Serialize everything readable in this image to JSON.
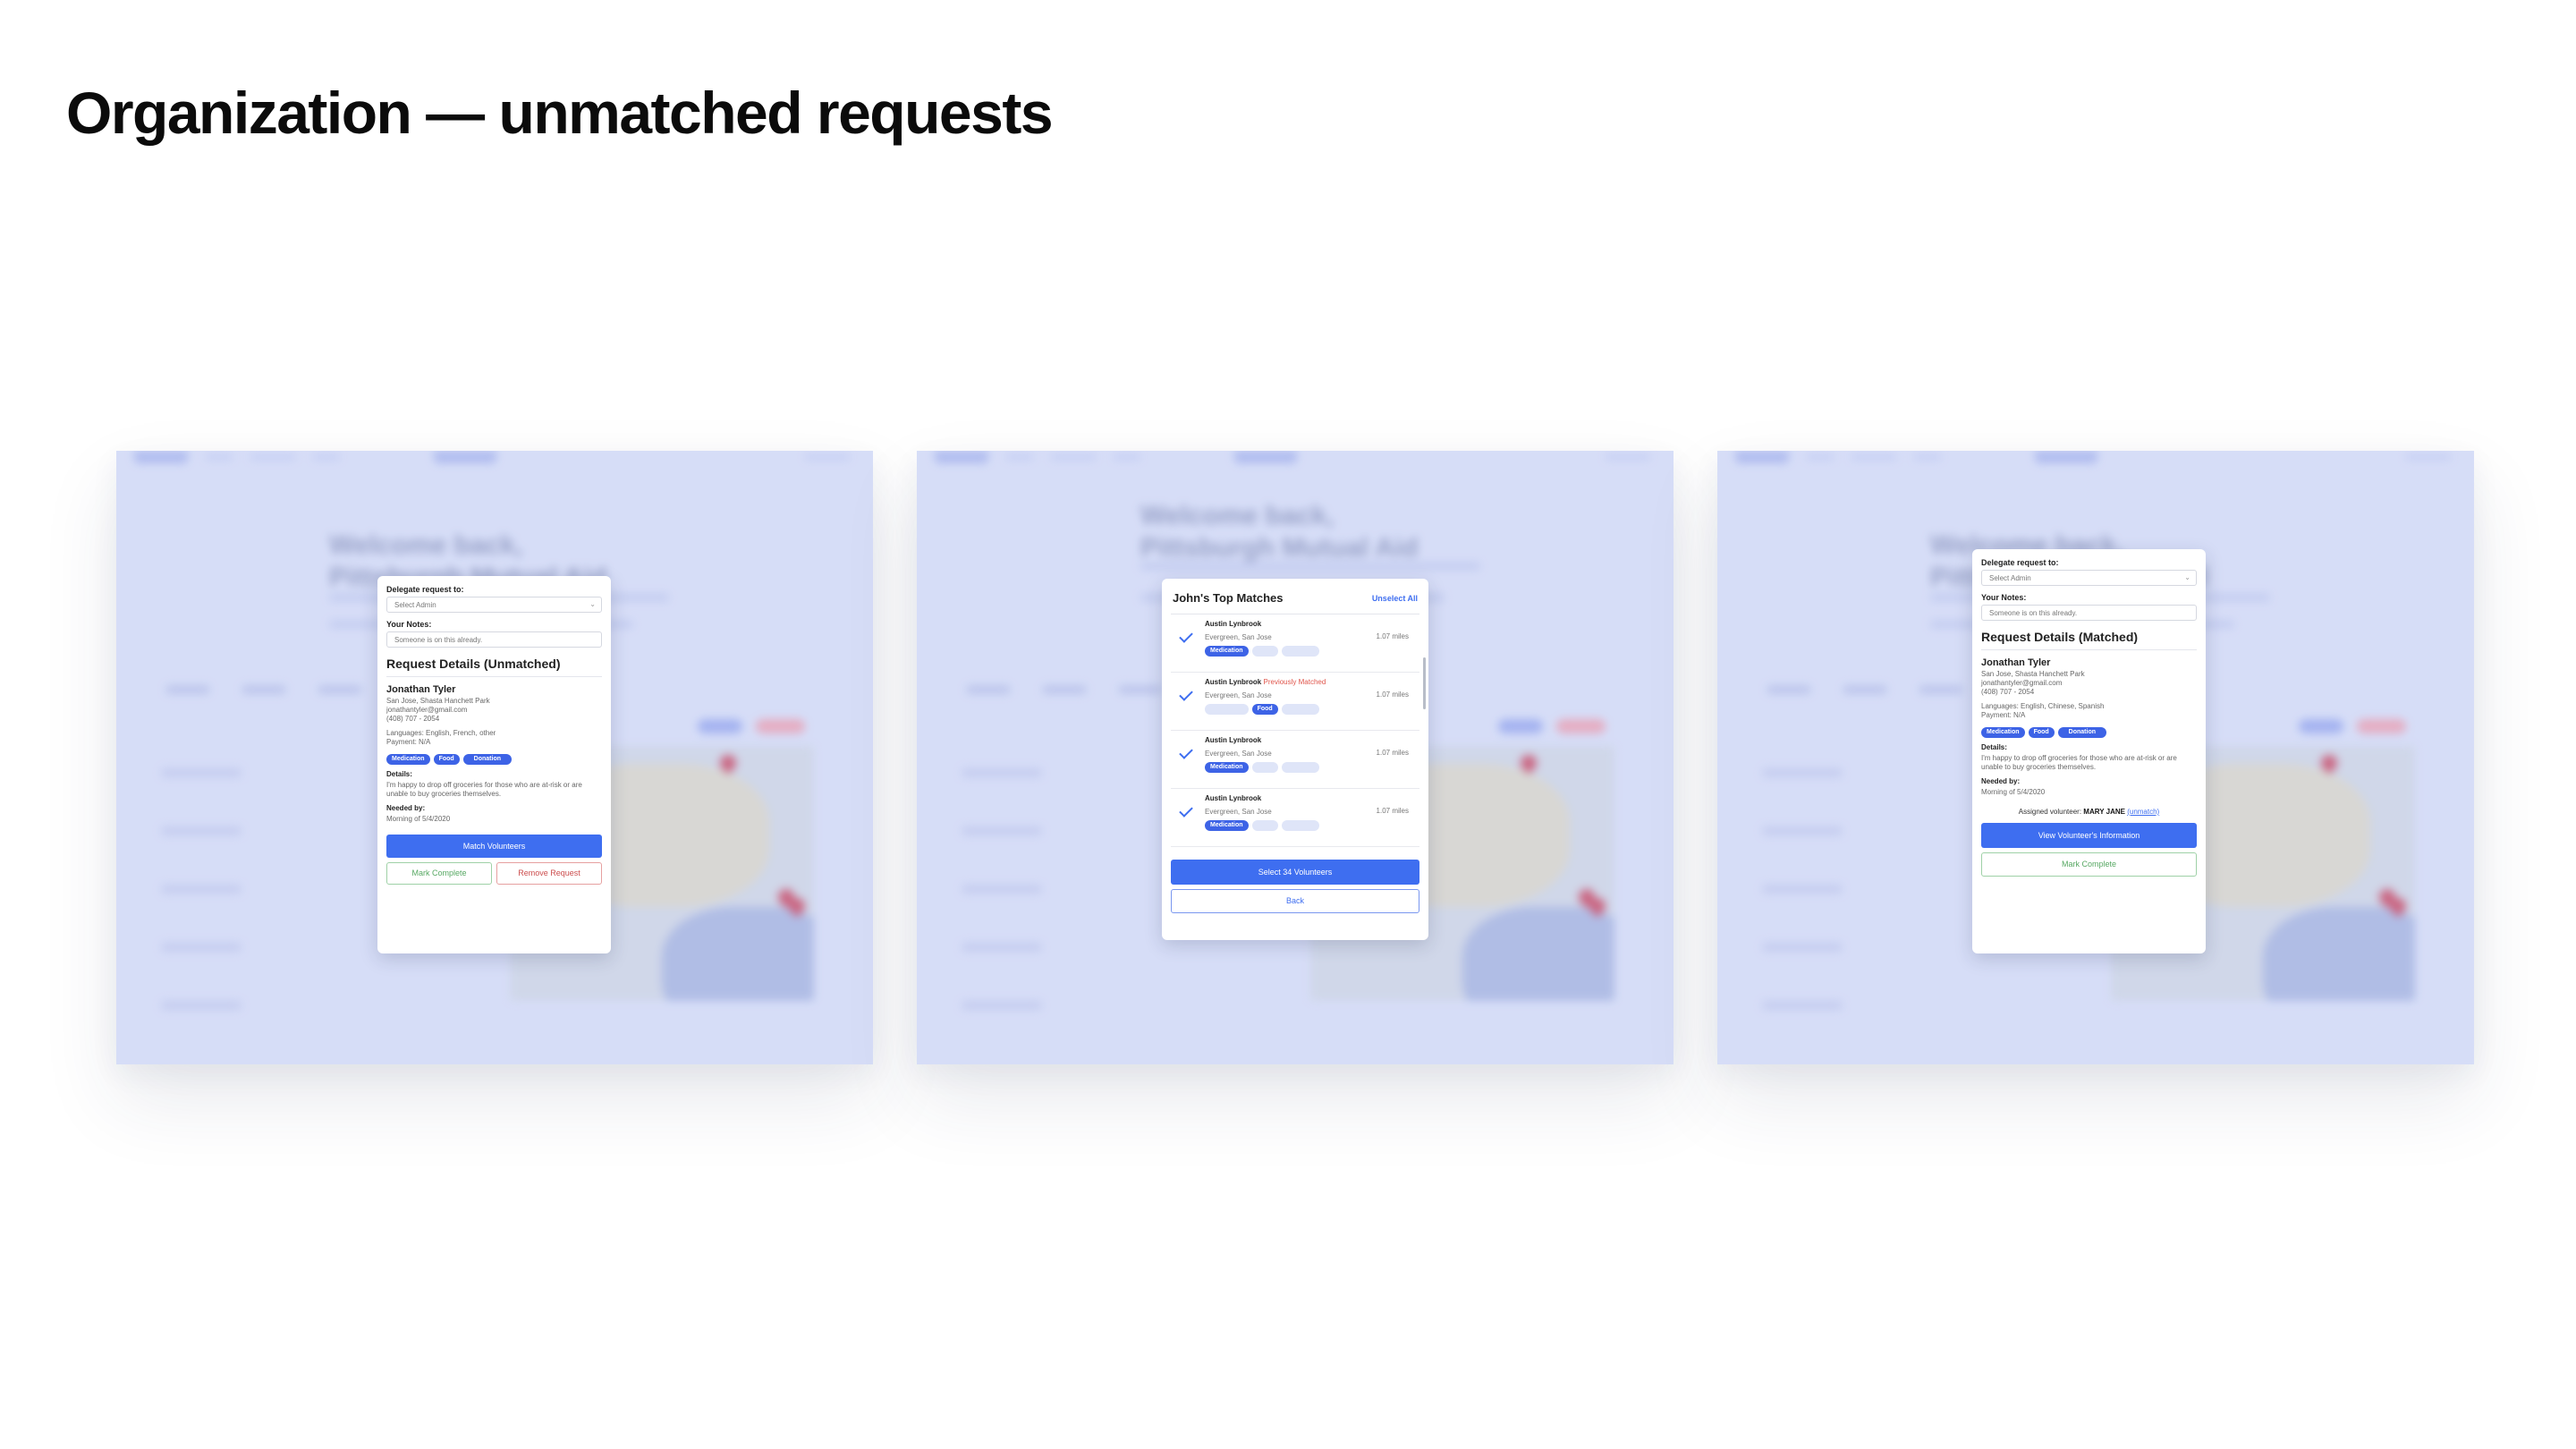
{
  "page_title": "Organization — unmatched requests",
  "colors": {
    "accent": "#3e6ef0",
    "tint": "#d6ddf7",
    "danger": "#cc4d4d",
    "success": "#57a863"
  },
  "icons": {
    "check": "check-icon",
    "chevron": "chevron-down-icon",
    "map_pin": "map-pin-icon"
  },
  "background": {
    "welcome_line1": "Welcome back,",
    "welcome_line2": "Pittsburgh Mutual Aid"
  },
  "screens": [
    {
      "delegate_label": "Delegate request to:",
      "delegate_select": "Select Admin",
      "notes_label": "Your Notes:",
      "notes_value": "Someone is on this already.",
      "section_title": "Request Details (Unmatched)",
      "name": "Jonathan Tyler",
      "address": "San Jose, Shasta Hanchett Park",
      "email": "jonathantyler@gmail.com",
      "phone": "(408) 707 - 2054",
      "languages": "Languages: English, French, other",
      "payment": "Payment: N/A",
      "tags": [
        "Medication",
        "Food",
        "Donation"
      ],
      "details_label": "Details:",
      "details": "I'm happy to drop off groceries for those who are at-risk or are unable to buy groceries themselves.",
      "needed_label": "Needed by:",
      "needed": "Morning of 5/4/2020",
      "primary_button": "Match Volunteers",
      "complete_button": "Mark Complete",
      "remove_button": "Remove Request"
    },
    {
      "title": "John's Top Matches",
      "unselect": "Unselect All",
      "matches": [
        {
          "name": "Austin Lynbrook",
          "flag": "",
          "location": "Evergreen, San Jose",
          "distance": "1.07 miles",
          "tags": [
            "Medication",
            "Food",
            "Donation"
          ]
        },
        {
          "name": "Austin Lynbrook",
          "flag": "Previously Matched",
          "location": "Evergreen, San Jose",
          "distance": "1.07 miles",
          "tags": [
            "Medication",
            "Food",
            "Donation"
          ]
        },
        {
          "name": "Austin Lynbrook",
          "flag": "",
          "location": "Evergreen, San Jose",
          "distance": "1.07 miles",
          "tags": [
            "Medication",
            "Food",
            "Donation"
          ]
        },
        {
          "name": "Austin Lynbrook",
          "flag": "",
          "location": "Evergreen, San Jose",
          "distance": "1.07 miles",
          "tags": [
            "Medication",
            "Food",
            "Donation"
          ]
        }
      ],
      "select_button": "Select 34 Volunteers",
      "back_button": "Back"
    },
    {
      "delegate_label": "Delegate request to:",
      "delegate_select": "Select Admin",
      "notes_label": "Your Notes:",
      "notes_value": "Someone is on this already.",
      "section_title": "Request Details (Matched)",
      "name": "Jonathan Tyler",
      "address": "San Jose, Shasta Hanchett Park",
      "email": "jonathantyler@gmail.com",
      "phone": "(408) 707 - 2054",
      "languages": "Languages: English, Chinese, Spanish",
      "payment": "Payment: N/A",
      "tags": [
        "Medication",
        "Food",
        "Donation"
      ],
      "details_label": "Details:",
      "details": "I'm happy to drop off groceries for those who are at-risk or are unable to buy groceries themselves.",
      "needed_label": "Needed by:",
      "needed": "Morning of 5/4/2020",
      "assigned_label": "Assigned volunteer:",
      "assigned_name": "MARY JANE",
      "unmatch": "(unmatch)",
      "primary_button": "View Volunteer's Information",
      "complete_button": "Mark Complete"
    }
  ]
}
